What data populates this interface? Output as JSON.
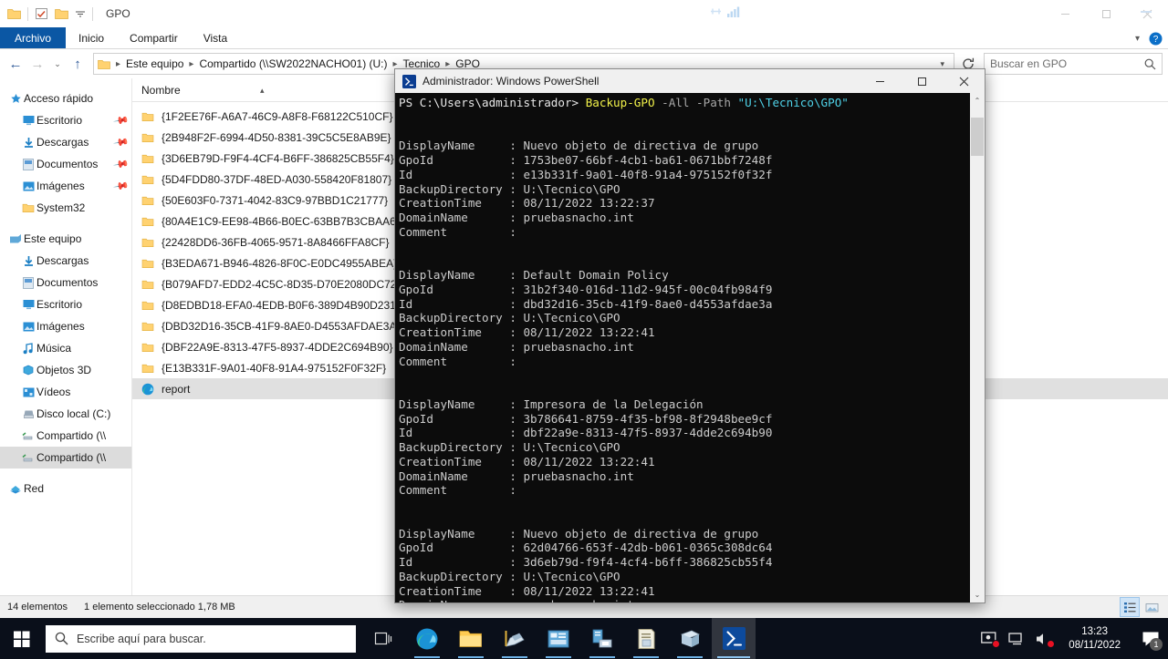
{
  "background_window": {
    "icons": [
      "network-icon",
      "signal-bars-icon"
    ]
  },
  "explorer": {
    "title": "GPO",
    "quick_access_toolbar": [
      {
        "name": "folder-icon",
        "label": ""
      },
      {
        "name": "properties-checkbox-icon",
        "label": ""
      },
      {
        "name": "new-folder-icon",
        "label": ""
      },
      {
        "name": "customize-chevron-icon",
        "label": ""
      }
    ],
    "window_controls": {
      "minimize": "—",
      "maximize": "❐",
      "close": "✕"
    },
    "ribbon": {
      "tabs": [
        {
          "label": "Archivo",
          "active": true
        },
        {
          "label": "Inicio",
          "active": false
        },
        {
          "label": "Compartir",
          "active": false
        },
        {
          "label": "Vista",
          "active": false
        }
      ],
      "expand_icon": "chevron-down-icon",
      "help_icon": "help-icon"
    },
    "address_bar": {
      "back": "←",
      "forward": "→",
      "recent": "⌄",
      "up": "↑",
      "breadcrumbs": [
        "Este equipo",
        "Compartido (\\\\SW2022NACHO01) (U:)",
        "Tecnico",
        "GPO"
      ],
      "dropdown_icon": "chevron-down-icon",
      "refresh_icon": "refresh-icon"
    },
    "search": {
      "placeholder": "Buscar en GPO",
      "value": "",
      "icon": "search-icon"
    },
    "nav_pane": [
      {
        "label": "Acceso rápido",
        "icon": "star-icon",
        "level": "root",
        "pinned": false,
        "selected": false
      },
      {
        "label": "Escritorio",
        "icon": "desktop-icon",
        "level": "child",
        "pinned": true,
        "selected": false
      },
      {
        "label": "Descargas",
        "icon": "download-icon",
        "level": "child",
        "pinned": true,
        "selected": false
      },
      {
        "label": "Documentos",
        "icon": "documents-icon",
        "level": "child",
        "pinned": true,
        "selected": false
      },
      {
        "label": "Imágenes",
        "icon": "pictures-icon",
        "level": "child",
        "pinned": true,
        "selected": false
      },
      {
        "label": "System32",
        "icon": "folder-icon",
        "level": "child",
        "pinned": false,
        "selected": false
      },
      {
        "label": "Este equipo",
        "icon": "this-pc-icon",
        "level": "root",
        "pinned": false,
        "selected": false
      },
      {
        "label": "Descargas",
        "icon": "download-icon",
        "level": "child",
        "pinned": false,
        "selected": false
      },
      {
        "label": "Documentos",
        "icon": "documents-icon",
        "level": "child",
        "pinned": false,
        "selected": false
      },
      {
        "label": "Escritorio",
        "icon": "desktop-icon",
        "level": "child",
        "pinned": false,
        "selected": false
      },
      {
        "label": "Imágenes",
        "icon": "pictures-icon",
        "level": "child",
        "pinned": false,
        "selected": false
      },
      {
        "label": "Música",
        "icon": "music-icon",
        "level": "child",
        "pinned": false,
        "selected": false
      },
      {
        "label": "Objetos 3D",
        "icon": "objects3d-icon",
        "level": "child",
        "pinned": false,
        "selected": false
      },
      {
        "label": "Vídeos",
        "icon": "videos-icon",
        "level": "child",
        "pinned": false,
        "selected": false
      },
      {
        "label": "Disco local (C:)",
        "icon": "drive-icon",
        "level": "child",
        "pinned": false,
        "selected": false
      },
      {
        "label": "Compartido (\\\\",
        "icon": "network-drive-icon",
        "level": "child",
        "pinned": false,
        "selected": false
      },
      {
        "label": "Compartido (\\\\",
        "icon": "network-drive-icon",
        "level": "child",
        "pinned": false,
        "selected": true
      },
      {
        "label": "Red",
        "icon": "network-icon",
        "level": "root",
        "pinned": false,
        "selected": false
      }
    ],
    "column_header": "Nombre",
    "files": [
      {
        "name": "{1F2EE76F-A6A7-46C9-A8F8-F68122C510CF}",
        "icon": "folder-icon",
        "selected": false
      },
      {
        "name": "{2B948F2F-6994-4D50-8381-39C5C5E8AB9E}",
        "icon": "folder-icon",
        "selected": false
      },
      {
        "name": "{3D6EB79D-F9F4-4CF4-B6FF-386825CB55F4}",
        "icon": "folder-icon",
        "selected": false
      },
      {
        "name": "{5D4FDD80-37DF-48ED-A030-558420F81807}",
        "icon": "folder-icon",
        "selected": false
      },
      {
        "name": "{50E603F0-7371-4042-83C9-97BBD1C21777}",
        "icon": "folder-icon",
        "selected": false
      },
      {
        "name": "{80A4E1C9-EE98-4B66-B0EC-63BB7B3CBAA6}",
        "icon": "folder-icon",
        "selected": false
      },
      {
        "name": "{22428DD6-36FB-4065-9571-8A8466FFA8CF}",
        "icon": "folder-icon",
        "selected": false
      },
      {
        "name": "{B3EDA671-B946-4826-8F0C-E0DC4955ABEA}",
        "icon": "folder-icon",
        "selected": false
      },
      {
        "name": "{B079AFD7-EDD2-4C5C-8D35-D70E2080DC72}",
        "icon": "folder-icon",
        "selected": false
      },
      {
        "name": "{D8EDBD18-EFA0-4EDB-B0F6-389D4B90D231}",
        "icon": "folder-icon",
        "selected": false
      },
      {
        "name": "{DBD32D16-35CB-41F9-8AE0-D4553AFDAE3A}",
        "icon": "folder-icon",
        "selected": false
      },
      {
        "name": "{DBF22A9E-8313-47F5-8937-4DDE2C694B90}",
        "icon": "folder-icon",
        "selected": false
      },
      {
        "name": "{E13B331F-9A01-40F8-91A4-975152F0F32F}",
        "icon": "folder-icon",
        "selected": false
      },
      {
        "name": "report",
        "icon": "edge-html-icon",
        "selected": true
      }
    ],
    "status_bar": {
      "item_count": "14 elementos",
      "selection": "1 elemento seleccionado  1,78 MB",
      "view_details_icon": "details-view-icon",
      "view_large_icon": "large-icons-view-icon"
    }
  },
  "powershell": {
    "title": "Administrador: Windows PowerShell",
    "icon": "powershell-icon",
    "window_controls": {
      "minimize": "—",
      "maximize": "❐",
      "close": "✕"
    },
    "prompt": "PS C:\\Users\\administrador> ",
    "command": {
      "cmdlet": "Backup-GPO",
      "params": " -All -Path ",
      "string": "\"U:\\Tecnico\\GPO\""
    },
    "field_labels": [
      "DisplayName",
      "GpoId",
      "Id",
      "BackupDirectory",
      "CreationTime",
      "DomainName",
      "Comment"
    ],
    "records": [
      {
        "DisplayName": "Nuevo objeto de directiva de grupo",
        "GpoId": "1753be07-66bf-4cb1-ba61-0671bbf7248f",
        "Id": "e13b331f-9a01-40f8-91a4-975152f0f32f",
        "BackupDirectory": "U:\\Tecnico\\GPO",
        "CreationTime": "08/11/2022 13:22:37",
        "DomainName": "pruebasnacho.int",
        "Comment": ""
      },
      {
        "DisplayName": "Default Domain Policy",
        "GpoId": "31b2f340-016d-11d2-945f-00c04fb984f9",
        "Id": "dbd32d16-35cb-41f9-8ae0-d4553afdae3a",
        "BackupDirectory": "U:\\Tecnico\\GPO",
        "CreationTime": "08/11/2022 13:22:41",
        "DomainName": "pruebasnacho.int",
        "Comment": ""
      },
      {
        "DisplayName": "Impresora de la Delegación",
        "GpoId": "3b786641-8759-4f35-bf98-8f2948bee9cf",
        "Id": "dbf22a9e-8313-47f5-8937-4dde2c694b90",
        "BackupDirectory": "U:\\Tecnico\\GPO",
        "CreationTime": "08/11/2022 13:22:41",
        "DomainName": "pruebasnacho.int",
        "Comment": ""
      },
      {
        "DisplayName": "Nuevo objeto de directiva de grupo",
        "GpoId": "62d04766-653f-42db-b061-0365c308dc64",
        "Id": "3d6eb79d-f9f4-4cf4-b6ff-386825cb55f4",
        "BackupDirectory": "U:\\Tecnico\\GPO",
        "CreationTime": "08/11/2022 13:22:41",
        "DomainName": "pruebasnacho.int",
        "Comment": ""
      }
    ],
    "scrollbar": {
      "up_arrow": "⌃",
      "down_arrow": "⌄"
    }
  },
  "taskbar": {
    "start_icon": "windows-start-icon",
    "search": {
      "placeholder": "Escribe aquí para buscar.",
      "icon": "search-icon"
    },
    "apps": [
      {
        "name": "task-view-icon",
        "state": "idle"
      },
      {
        "name": "edge-icon",
        "state": "running"
      },
      {
        "name": "file-explorer-icon",
        "state": "running"
      },
      {
        "name": "server-manager-icon",
        "state": "running"
      },
      {
        "name": "dns-manager-icon",
        "state": "running"
      },
      {
        "name": "print-management-icon",
        "state": "running"
      },
      {
        "name": "event-viewer-icon",
        "state": "running"
      },
      {
        "name": "group-policy-management-icon",
        "state": "running"
      },
      {
        "name": "powershell-icon",
        "state": "active"
      }
    ],
    "tray": [
      {
        "name": "remote-desktop-icon",
        "badge": true
      },
      {
        "name": "network-icon",
        "badge": false
      },
      {
        "name": "volume-muted-icon",
        "badge": true
      }
    ],
    "clock": {
      "time": "13:23",
      "date": "08/11/2022"
    },
    "notifications": {
      "icon": "action-center-icon",
      "count": "1"
    }
  },
  "colors": {
    "accent": "#0b57a4",
    "console_bg": "#0c0c0c",
    "console_fg": "#cccccc",
    "cmdlet_yellow": "#f3f34a",
    "string_cyan": "#4fd2e8",
    "taskbar_bg": "#0a0f1a",
    "selection_gray": "#e0e0e0"
  }
}
